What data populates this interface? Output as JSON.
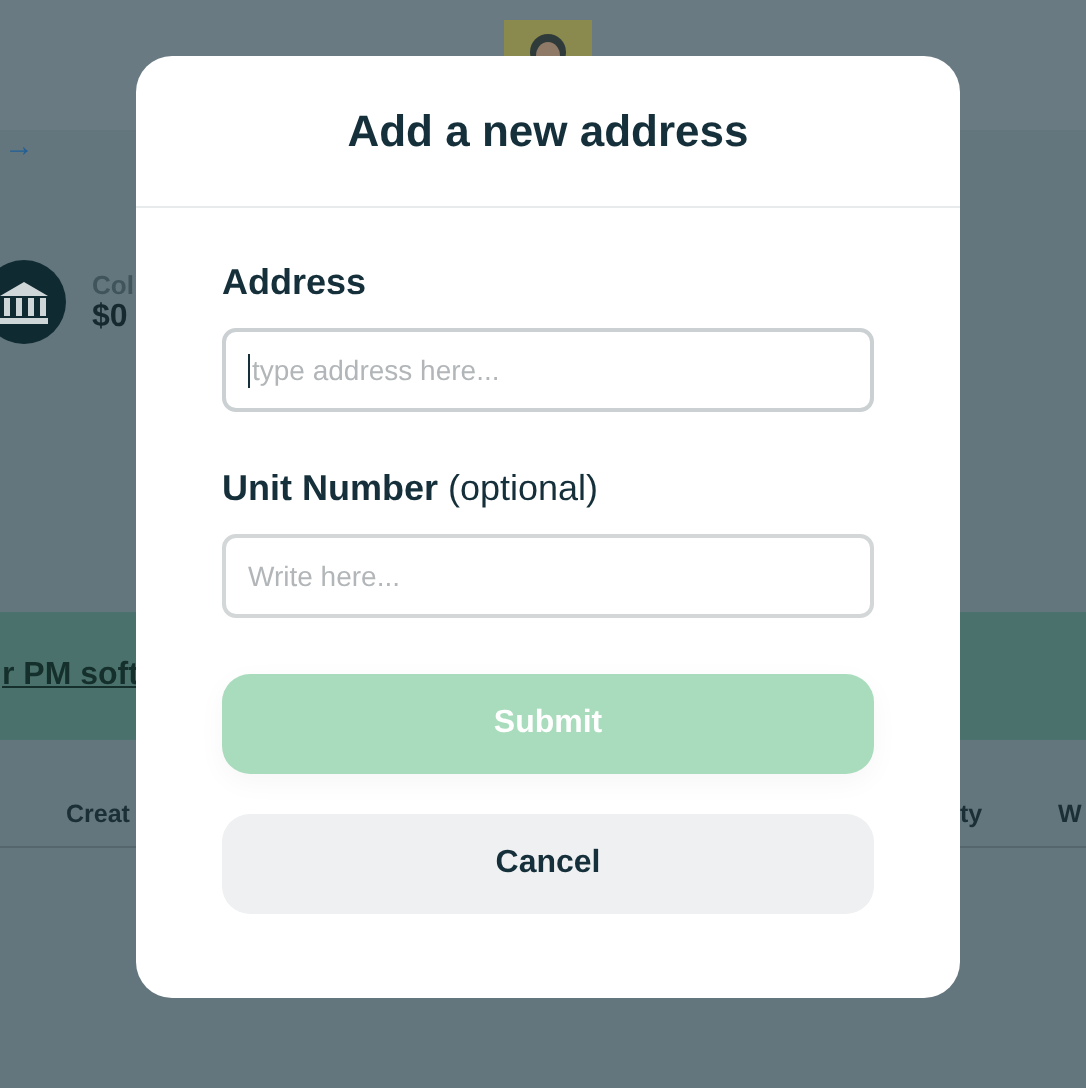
{
  "background": {
    "nav_arrow": "→",
    "account": {
      "label": "Col",
      "amount": "$0"
    },
    "banner": {
      "link": "r PM soft"
    },
    "table": {
      "columns": [
        "Creat",
        "ty",
        "W"
      ]
    }
  },
  "modal": {
    "title": "Add a new address",
    "fields": [
      {
        "label": "Address",
        "placeholder": "type address here...",
        "focused": true
      },
      {
        "label": "**Unit Number** (optional)",
        "placeholder": "Write here...",
        "focused": false
      }
    ],
    "buttons": [
      {
        "label": "Submit",
        "kind": "primary",
        "disabled": true
      },
      {
        "label": "Cancel",
        "kind": "secondary",
        "disabled": false
      }
    ]
  }
}
